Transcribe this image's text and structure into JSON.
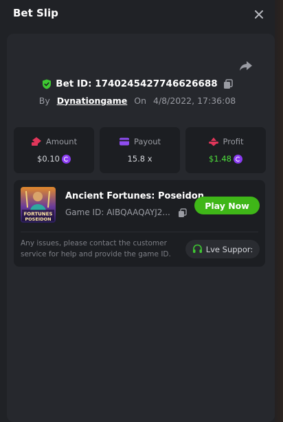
{
  "header": {
    "title": "Bet Slip"
  },
  "bet": {
    "id_label": "Bet ID:",
    "id": "1740245427746626688",
    "by_label": "By",
    "user": "Dynationgame",
    "on_label": "On",
    "datetime": "4/8/2022, 17:36:08"
  },
  "stats": {
    "amount": {
      "label": "Amount",
      "value": "$0.10"
    },
    "payout": {
      "label": "Payout",
      "value": "15.8 x"
    },
    "profit": {
      "label": "Profit",
      "value": "$1.48"
    }
  },
  "game": {
    "name": "Ancient Fortunes: Poseidon",
    "id_label": "Game ID:",
    "id": "AIBQAAQAYJ2...",
    "thumb_text_1": "FORTUNES",
    "thumb_text_2": "POSEIDON",
    "play_label": "Play Now"
  },
  "support": {
    "help_text": "Any issues, please contact the customer service for help and provide the game ID.",
    "button_label": "Lve Suppor:"
  },
  "colors": {
    "accent_green": "#3fb618",
    "profit_green": "#4ede3c",
    "coin_purple": "#8a3bf2",
    "amount_red": "#e0365a",
    "payout_purple": "#8e4cf0"
  }
}
